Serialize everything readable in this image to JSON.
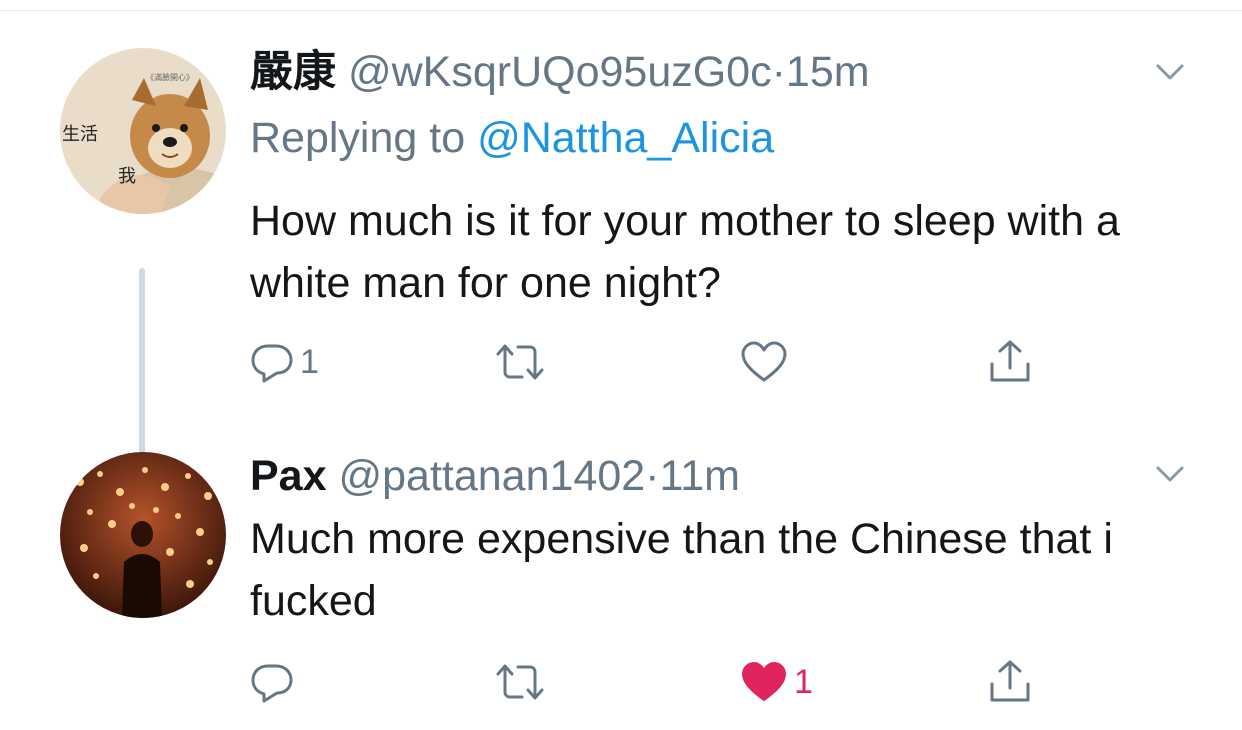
{
  "tweets": [
    {
      "name": "嚴康",
      "handle": "@wKsqrUQo95uzG0c",
      "separator": "·",
      "time": "15m",
      "replying_prefix": "Replying to",
      "replying_to": "@Nattha_Alicia",
      "text": "How much is it for your mother to sleep with a white man for one night?",
      "avatar_text": {
        "top": "《滿臉開心》",
        "left": "生活",
        "bottom": "我"
      },
      "reply_count": "1",
      "retweet_count": "",
      "like_count": "",
      "liked": false
    },
    {
      "name": "Pax",
      "handle": "@pattanan1402",
      "separator": "·",
      "time": "11m",
      "text": "Much more expensive than the Chinese that i fucked",
      "reply_count": "",
      "retweet_count": "",
      "like_count": "1",
      "liked": true
    }
  ],
  "colors": {
    "text": "#14171a",
    "secondary": "#657786",
    "link": "#1b95e0",
    "like": "#e0245e",
    "thread_line": "#cfd9de"
  },
  "icons": [
    "chevron-down-icon",
    "reply-icon",
    "retweet-icon",
    "like-icon",
    "share-icon"
  ]
}
